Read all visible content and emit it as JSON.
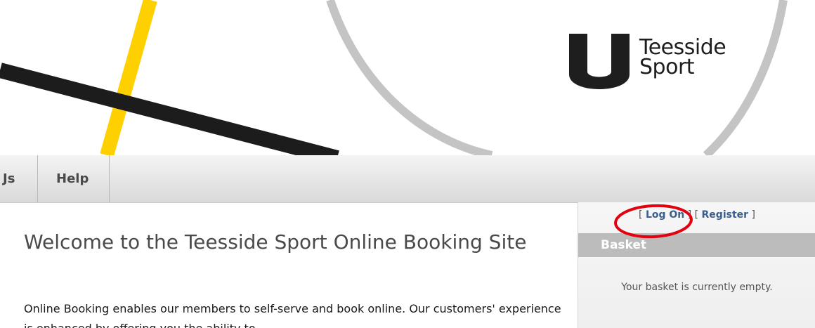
{
  "brand": {
    "line1": "Teesside",
    "line2": "Sport",
    "logo_icon": "teesside-sport-logo-icon"
  },
  "nav": {
    "items": [
      {
        "label": "Js"
      },
      {
        "label": "Help"
      }
    ]
  },
  "main": {
    "title": "Welcome to the Teesside Sport Online Booking Site",
    "intro": "Online Booking enables our members to self-serve and book online. Our customers' experience is enhanced by offering you the ability to"
  },
  "sidebar": {
    "bracket_open_1": "[ ",
    "login_label": "Log On",
    "bracket_mid": " ] [ ",
    "register_label": "Register",
    "bracket_close": " ]",
    "basket_title": "Basket",
    "basket_empty_text": "Your basket is currently empty."
  },
  "colors": {
    "accent_yellow": "#ffd000",
    "stripe_black": "#1c1c1c",
    "circle_gray": "#c4c4c4",
    "link_blue": "#3a5f8f",
    "annotation_red": "#e3000f"
  }
}
